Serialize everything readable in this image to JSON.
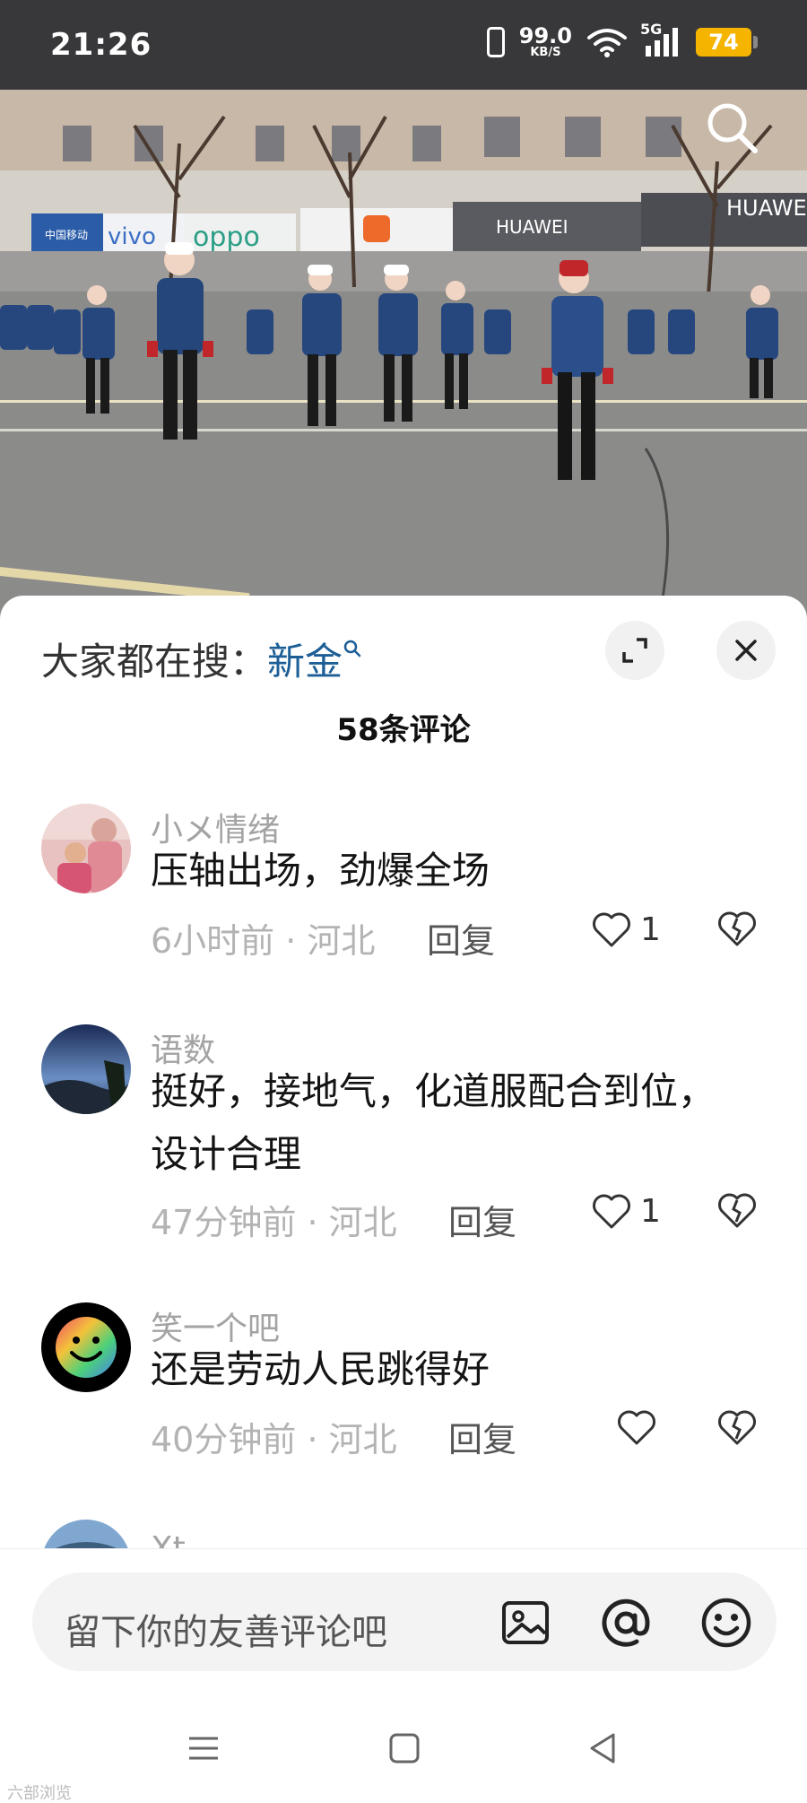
{
  "status_bar": {
    "time": "21:26",
    "net_speed_value": "99.0",
    "net_speed_unit": "KB/S",
    "cell_type": "5G",
    "battery": "74"
  },
  "video": {
    "signs": [
      "中国移动 China Mobile",
      "vivo",
      "oppo",
      "mi",
      "HUAWEI",
      "HUAWEI"
    ]
  },
  "panel": {
    "hot_search_label": "大家都在搜：",
    "hot_search_keyword": "新金",
    "comment_count": "58条评论"
  },
  "comments": [
    {
      "user": "小メ情绪",
      "text": "压轴出场，劲爆全场",
      "time": "6小时前",
      "sep": "·",
      "location": "河北",
      "reply": "回复",
      "likes": "1"
    },
    {
      "user": "语数",
      "text": "挺好，接地气，化道服配合到位，设计合理",
      "time": "47分钟前",
      "sep": "·",
      "location": "河北",
      "reply": "回复",
      "likes": "1"
    },
    {
      "user": "笑一个吧",
      "text": "还是劳动人民跳得好",
      "time": "40分钟前",
      "sep": "·",
      "location": "河北",
      "reply": "回复",
      "likes": ""
    },
    {
      "user": "Xt"
    }
  ],
  "input": {
    "placeholder": "留下你的友善评论吧"
  },
  "watermark": "六部浏览",
  "colors": {
    "keyword_blue": "#1c5e96",
    "battery_yellow": "#f4b400",
    "meta_gray": "#b3b3b3"
  }
}
